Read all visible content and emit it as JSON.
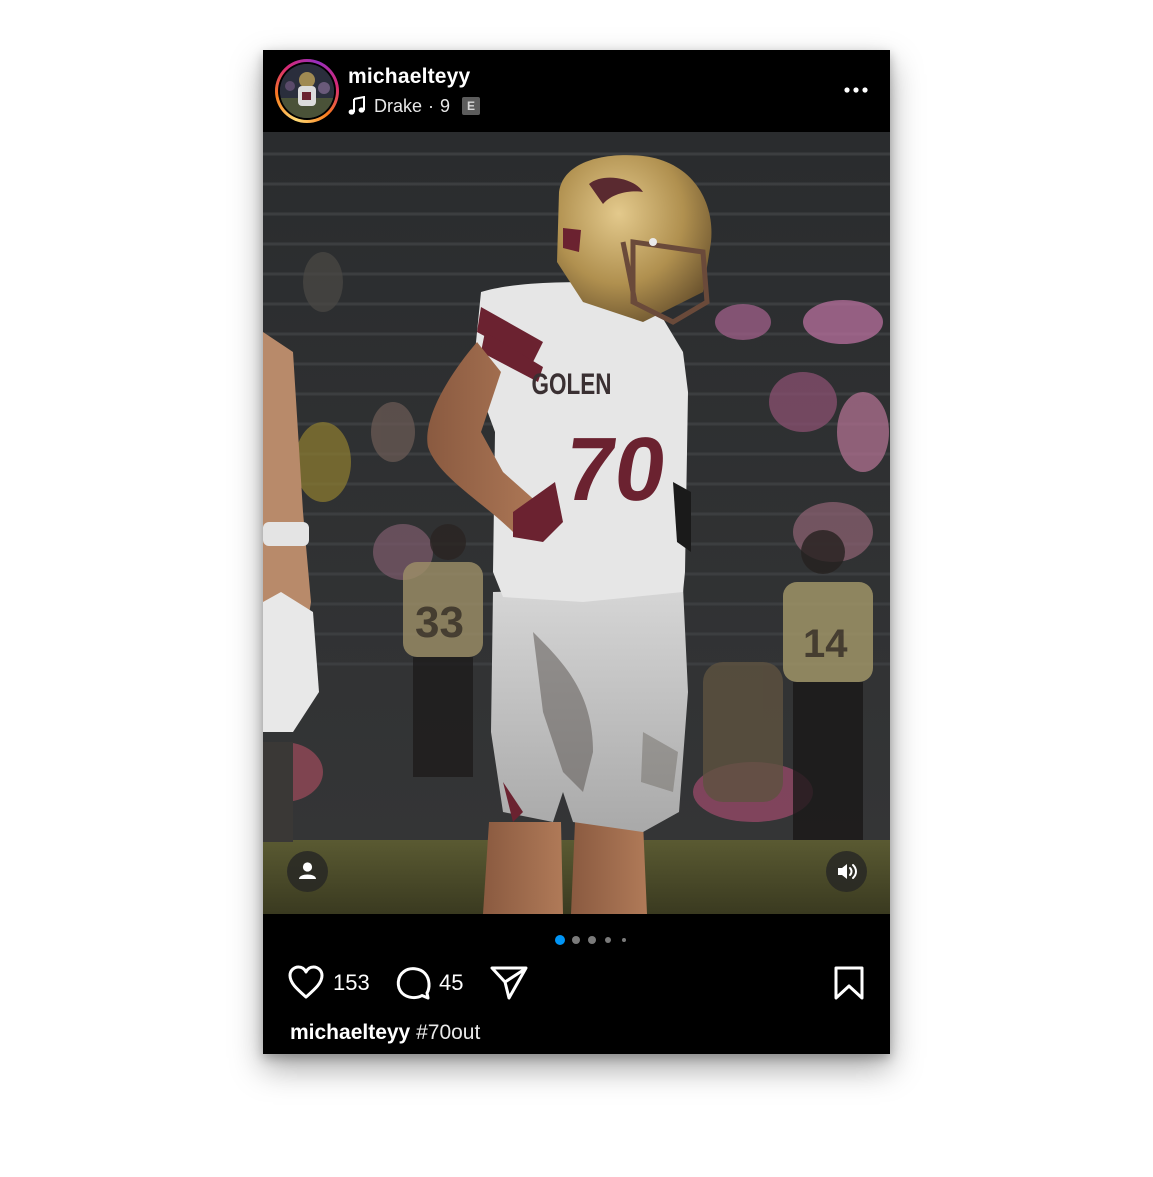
{
  "post": {
    "username": "michaelteyy",
    "music": {
      "artist": "Drake",
      "separator": "·",
      "track": "9",
      "explicit_badge": "E"
    },
    "likes": "153",
    "comments": "45",
    "carousel": {
      "count": 5,
      "active_index": 0
    },
    "caption": {
      "username": "michaelteyy",
      "text": "#70out"
    },
    "photo": {
      "jersey_text": "GOLEN",
      "jersey_number": "70",
      "bg_numbers": [
        "33",
        "14"
      ]
    }
  },
  "icons": {
    "more": "more-horizontal-icon",
    "music": "music-note-icon",
    "tag_people": "person-icon",
    "sound": "speaker-icon",
    "like": "heart-icon",
    "comment": "comment-bubble-icon",
    "share": "paper-plane-icon",
    "save": "bookmark-icon"
  },
  "colors": {
    "background": "#000000",
    "active_dot": "#0095f6",
    "inactive_dot": "#7a7a7a",
    "text": "#ffffff"
  }
}
